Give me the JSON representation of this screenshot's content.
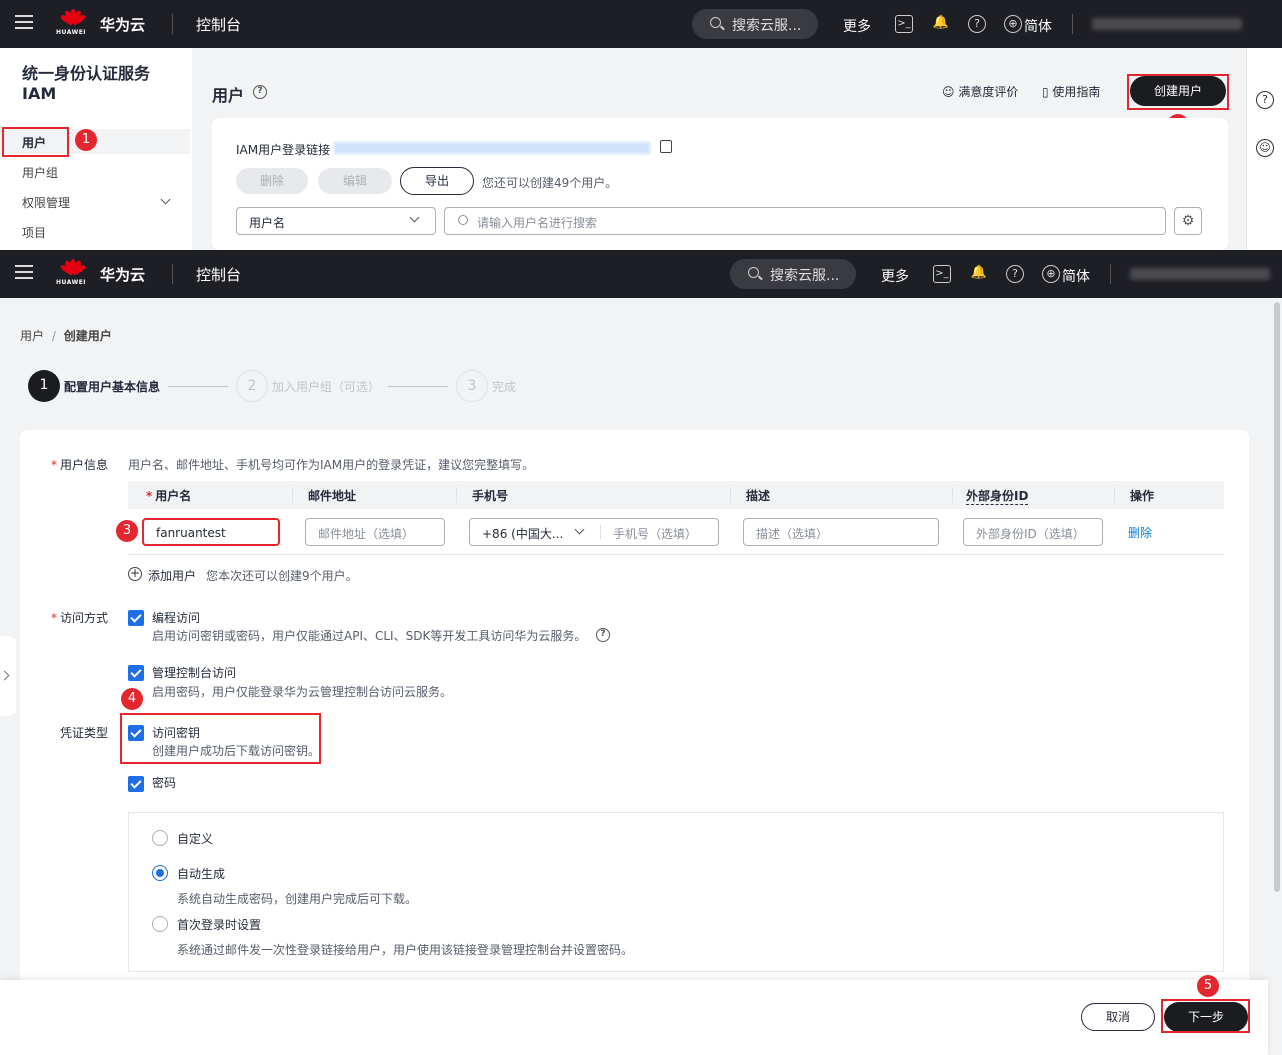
{
  "topbar": {
    "brand": "华为云",
    "logo_text": "HUAWEI",
    "console": "控制台",
    "search": "搜索云服...",
    "more": "更多",
    "lang": "简体"
  },
  "upper": {
    "service_title": "统一身份认证服务 IAM",
    "sidebar": [
      {
        "label": "用户"
      },
      {
        "label": "用户组"
      },
      {
        "label": "权限管理"
      },
      {
        "label": "项目"
      }
    ],
    "page_title": "用户",
    "satisfaction": "满意度评价",
    "guide": "使用指南",
    "create_user": "创建用户",
    "login_link_label": "IAM用户登录链接",
    "delete": "删除",
    "edit": "编辑",
    "export": "导出",
    "quota_text": "您还可以创建49个用户。",
    "filter_select": "用户名",
    "search_placeholder": "请输入用户名进行搜索"
  },
  "lower": {
    "breadcrumb": {
      "root": "用户",
      "sep": "/",
      "current": "创建用户"
    },
    "steps": [
      {
        "num": "1",
        "label": "配置用户基本信息"
      },
      {
        "num": "2",
        "label": "加入用户组（可选）"
      },
      {
        "num": "3",
        "label": "完成"
      }
    ],
    "user_info_label": "用户信息",
    "user_info_hint": "用户名、邮件地址、手机号均可作为IAM用户的登录凭证，建议您完整填写。",
    "columns": [
      "用户名",
      "邮件地址",
      "手机号",
      "描述",
      "外部身份ID",
      "操作"
    ],
    "row": {
      "username": "fanruantest",
      "email_ph": "邮件地址（选填）",
      "country": "+86 (中国大...",
      "phone_ph": "手机号（选填）",
      "desc_ph": "描述（选填）",
      "extid_ph": "外部身份ID（选填）",
      "delete": "删除"
    },
    "add_user": "添加用户",
    "add_user_hint": "您本次还可以创建9个用户。",
    "access_label": "访问方式",
    "prog_access": "编程访问",
    "prog_access_desc": "启用访问密钥或密码，用户仅能通过API、CLI、SDK等开发工具访问华为云服务。",
    "console_access": "管理控制台访问",
    "console_access_desc": "启用密码，用户仅能登录华为云管理控制台访问云服务。",
    "cred_label": "凭证类型",
    "access_key": "访问密钥",
    "access_key_desc": "创建用户成功后下载访问密钥。",
    "password": "密码",
    "pw_custom": "自定义",
    "pw_auto": "自动生成",
    "pw_auto_desc": "系统自动生成密码，创建用户完成后可下载。",
    "pw_first": "首次登录时设置",
    "pw_first_desc": "系统通过邮件发一次性登录链接给用户，用户使用该链接登录管理控制台并设置密码。",
    "cancel": "取消",
    "next": "下一步"
  },
  "markers": [
    "1",
    "2",
    "3",
    "4",
    "5"
  ],
  "colors": {
    "accent_red": "#e6262e",
    "checkbox_blue": "#1e6ee8",
    "dark": "#1b1c20"
  }
}
